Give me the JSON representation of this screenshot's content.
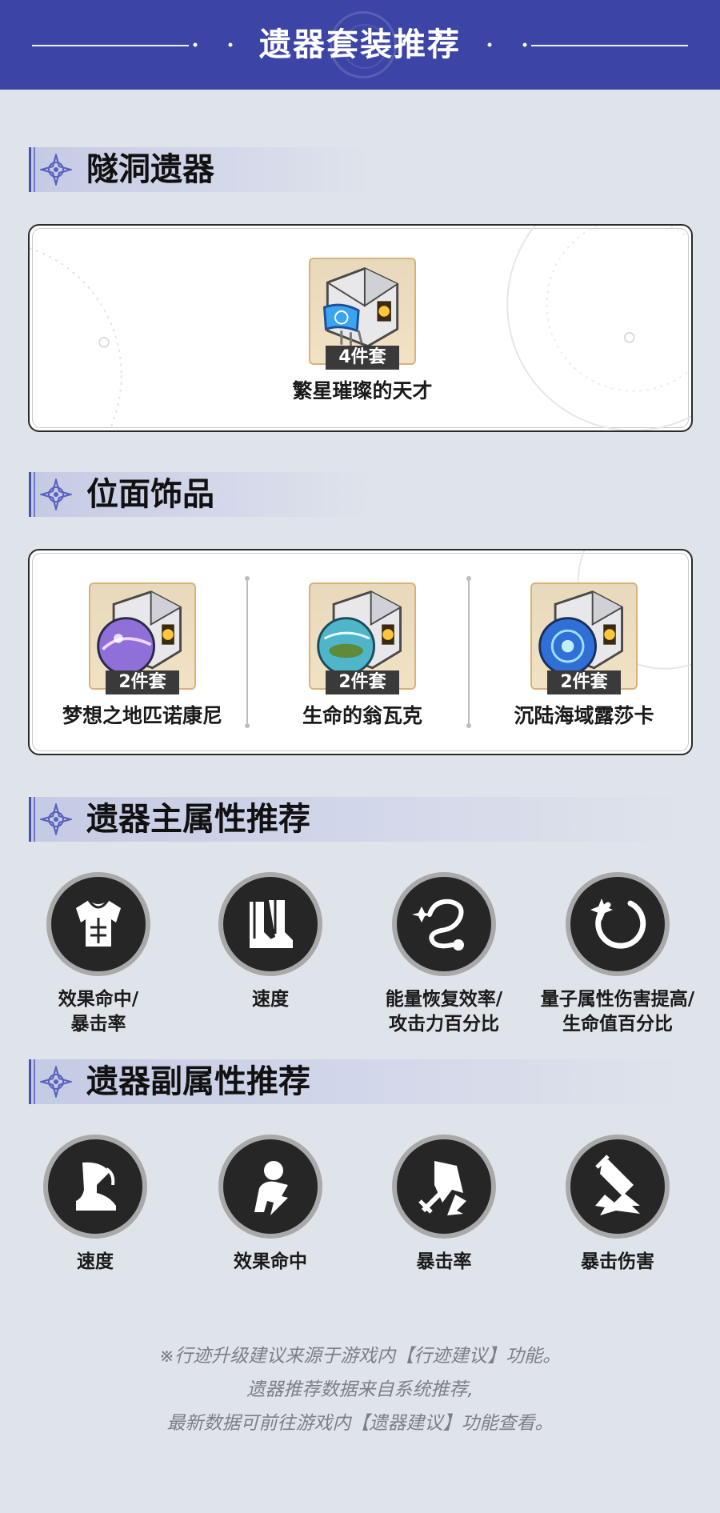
{
  "header": {
    "title": "遗器套装推荐"
  },
  "sections": {
    "cavern": "隧洞遗器",
    "planar": "位面饰品",
    "main_stats": "遗器主属性推荐",
    "sub_stats": "遗器副属性推荐"
  },
  "cavern_relics": [
    {
      "tag": "4件套",
      "name": "繁星璀璨的天才",
      "orb_icon": "genius-orb-icon",
      "accent": "#3f8fe0"
    }
  ],
  "planar_ornaments": [
    {
      "tag": "2件套",
      "name": "梦想之地匹诺康尼",
      "orb_icon": "penacony-orb-icon",
      "accent": "#8f6fd8"
    },
    {
      "tag": "2件套",
      "name": "生命的翁瓦克",
      "orb_icon": "vonwacq-orb-icon",
      "accent": "#4fb6c9"
    },
    {
      "tag": "2件套",
      "name": "沉陆海域露莎卡",
      "orb_icon": "rutilant-orb-icon",
      "accent": "#2f6fd6"
    }
  ],
  "main_stats": [
    {
      "icon": "body-armor-icon",
      "line1": "效果命中/",
      "line2": "暴击率"
    },
    {
      "icon": "boots-icon",
      "line1": "速度",
      "line2": ""
    },
    {
      "icon": "planar-sphere-icon",
      "line1": "能量恢复效率/",
      "line2": "攻击力百分比"
    },
    {
      "icon": "link-rope-icon",
      "line1": "量子属性伤害提高/",
      "line2": "生命值百分比"
    }
  ],
  "sub_stats": [
    {
      "icon": "speed-boot-icon",
      "label": "速度"
    },
    {
      "icon": "effect-hit-icon",
      "label": "效果命中"
    },
    {
      "icon": "crit-rate-icon",
      "label": "暴击率"
    },
    {
      "icon": "crit-damage-icon",
      "label": "暴击伤害"
    }
  ],
  "footer": {
    "line1": "※行迹升级建议来源于游戏内【行迹建议】功能。",
    "line2": "遗器推荐数据来自系统推荐,",
    "line3": "最新数据可前往游戏内【遗器建议】功能查看。"
  },
  "colors": {
    "header_bg": "#3c45a6",
    "page_bg": "#dfe3ea",
    "tag_bg": "#3a3a3a",
    "icon_ring": "#a9a9a9",
    "icon_fill": "#262626"
  }
}
